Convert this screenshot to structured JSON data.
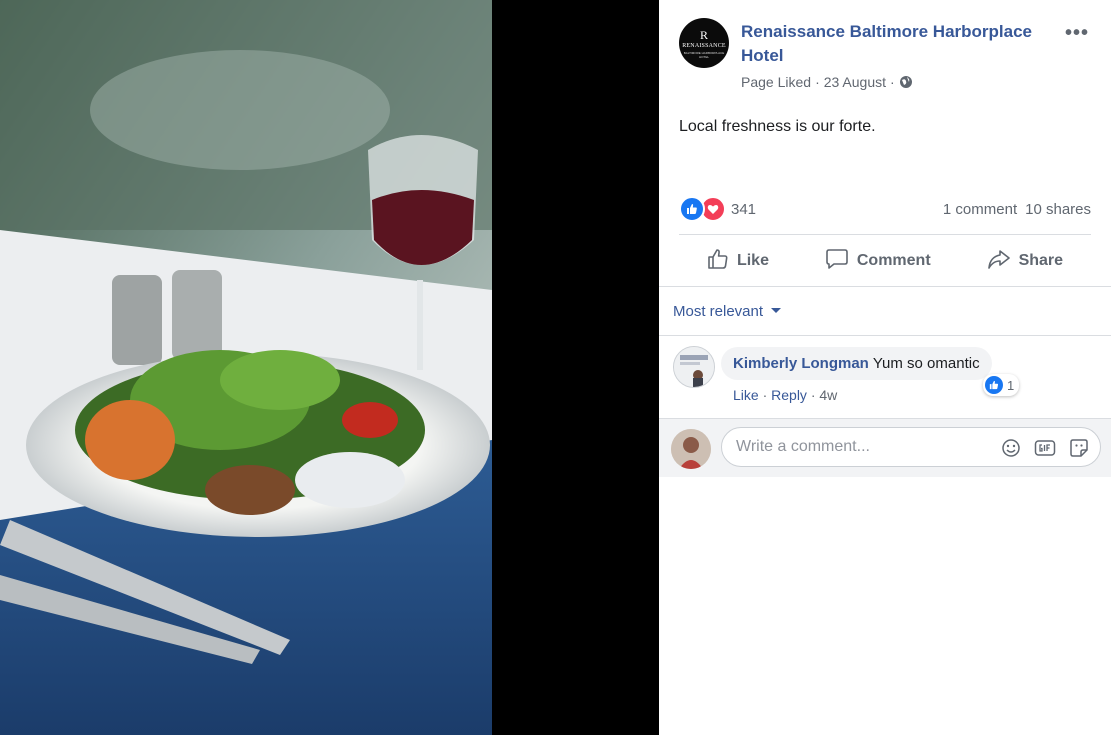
{
  "post": {
    "page_name": "Renaissance Baltimore Harborplace Hotel",
    "page_logo": {
      "letter": "R",
      "name": "RENAISSANCE",
      "sub": "BALTIMORE HARBORPLACE HOTEL"
    },
    "liked_status": "Page Liked",
    "date": "23 August",
    "privacy_icon": "globe-icon",
    "more_icon": "ellipsis-icon",
    "text": "Local freshness is our forte.",
    "reaction_count": "341",
    "comments_count": "1 comment",
    "shares_count": "10 shares"
  },
  "actions": {
    "like": "Like",
    "comment": "Comment",
    "share": "Share"
  },
  "comments": {
    "sort_label": "Most relevant",
    "items": [
      {
        "author": "Kimberly Longman",
        "text": "Yum so omantic",
        "reaction_count": "1",
        "like": "Like",
        "reply": "Reply",
        "age": "4w"
      }
    ]
  },
  "composer": {
    "placeholder": "Write a comment..."
  },
  "colors": {
    "link": "#385898",
    "like_blue": "#1877f2",
    "love_red": "#f33e58"
  }
}
